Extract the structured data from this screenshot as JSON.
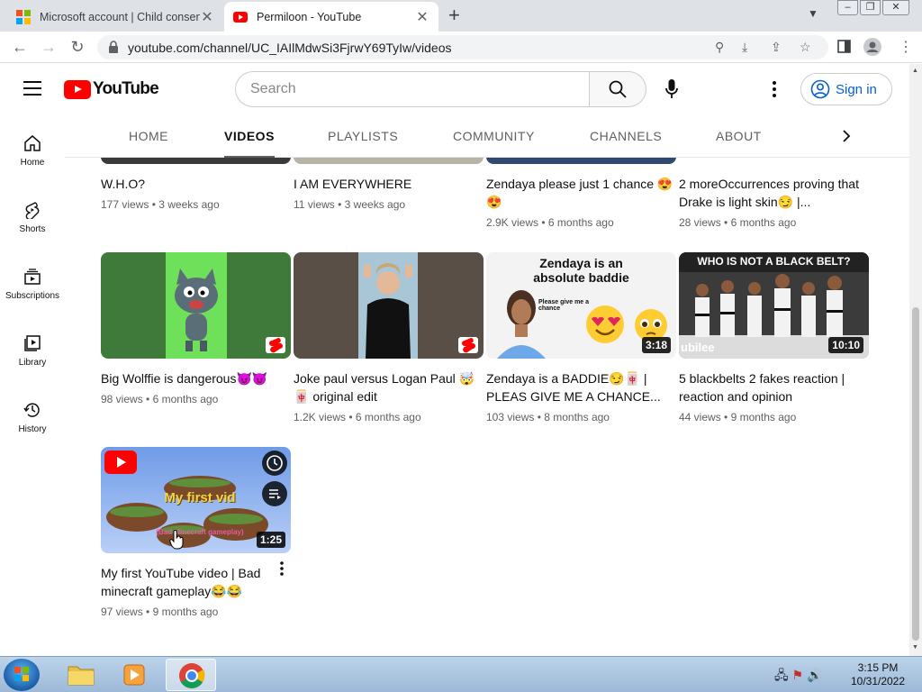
{
  "browser": {
    "tabs": [
      {
        "title": "Microsoft account | Child consent",
        "active": false
      },
      {
        "title": "Permiloon - YouTube",
        "active": true
      }
    ],
    "new_tab_symbol": "+",
    "url": "youtube.com/channel/UC_IAIlMdwSi3FjrwY69TyIw/videos"
  },
  "masthead": {
    "logo_text": "YouTube",
    "search_placeholder": "Search",
    "signin_label": "Sign in"
  },
  "guide": {
    "items": [
      {
        "label": "Home",
        "icon": "home-icon"
      },
      {
        "label": "Shorts",
        "icon": "shorts-icon"
      },
      {
        "label": "Subscriptions",
        "icon": "subscriptions-icon"
      },
      {
        "label": "Library",
        "icon": "library-icon"
      },
      {
        "label": "History",
        "icon": "history-icon"
      }
    ]
  },
  "channel_tabs": {
    "items": [
      "HOME",
      "VIDEOS",
      "PLAYLISTS",
      "COMMUNITY",
      "CHANNELS",
      "ABOUT"
    ],
    "active": "VIDEOS"
  },
  "videos": [
    {
      "title": "W.H.O?",
      "views": "177 views",
      "age": "3 weeks ago"
    },
    {
      "title": "I AM EVERYWHERE",
      "views": "11 views",
      "age": "3 weeks ago"
    },
    {
      "title": "Zendaya please just 1 chance 😍😍",
      "views": "2.9K views",
      "age": "6 months ago"
    },
    {
      "title": "2 moreOccurrences proving that Drake is light skin😏 |...",
      "views": "28 views",
      "age": "6 months ago"
    },
    {
      "title": "Big Wolffie is dangerous😈😈",
      "views": "98 views",
      "age": "6 months ago",
      "thumb_label": "",
      "badge": "shorts"
    },
    {
      "title": "Joke paul versus Logan Paul 🤯🀄 original edit",
      "views": "1.2K views",
      "age": "6 months ago",
      "badge": "shorts"
    },
    {
      "title": "Zendaya is a BADDIE😏🀄 | PLEAS GIVE ME A CHANCE...",
      "views": "103 views",
      "age": "8 months ago",
      "duration": "3:18",
      "thumb_text1": "Zendaya is an",
      "thumb_text2": "absolute baddie",
      "thumb_text3": "Please give me a chance"
    },
    {
      "title": "5 blackbelts 2 fakes reaction | reaction and opinion",
      "views": "44 views",
      "age": "9 months ago",
      "duration": "10:10",
      "thumb_text1": "WHO IS NOT A BLACK BELT?",
      "thumb_text2": "ubilee"
    },
    {
      "title": "My first YouTube video | Bad minecraft gameplay😂😂",
      "views": "97 views",
      "age": "9 months ago",
      "duration": "1:25",
      "thumb_text1": "My first vid",
      "thumb_text2": "(Bad Minecraft gameplay)"
    }
  ],
  "taskbar": {
    "time": "3:15 PM",
    "date": "10/31/2022"
  },
  "colors": {
    "youtube_red": "#ff0000",
    "link_blue": "#065fd4",
    "tab_strip": "#dee1e6"
  }
}
